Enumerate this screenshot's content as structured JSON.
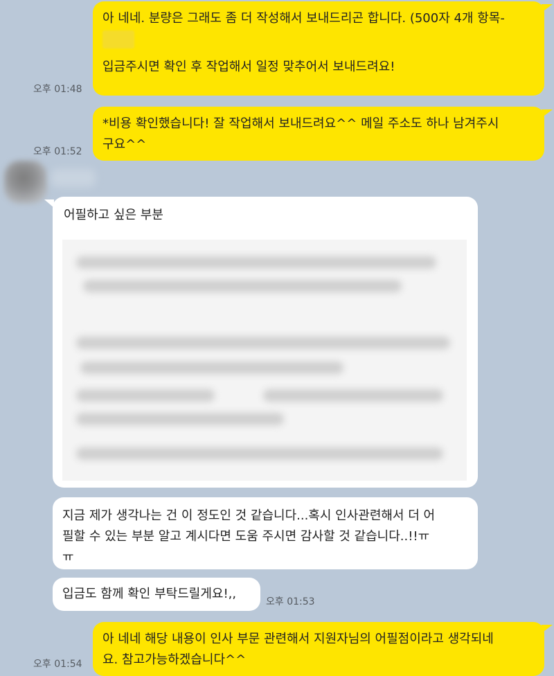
{
  "chat": {
    "messages": [
      {
        "sender": "me",
        "lines": [
          "아 네네. 분량은 그래도 좀 더 작성해서 보내드리곤 합니다. (500자 4개 항목-",
          "",
          "입금주시면 확인 후 작업해서 일정 맞추어서 보내드려요!"
        ],
        "time": "오후 01:48"
      },
      {
        "sender": "me",
        "lines": [
          "*비용 확인했습니다! 잘 작업해서 보내드려요^^ 메일 주소도 하나 남겨주시",
          "구요^^"
        ],
        "time": "오후 01:52"
      },
      {
        "sender": "other",
        "lines": [
          "어필하고 싶은 부분"
        ],
        "note": "blurred-content"
      },
      {
        "sender": "other",
        "lines": [
          "지금 제가 생각나는 건 이 정도인 것 같습니다...혹시 인사관련해서 더 어",
          "필할 수 있는 부분 알고 계시다면 도움 주시면 감사할 것 같습니다..!!ㅠ",
          "ㅠ"
        ]
      },
      {
        "sender": "other",
        "lines": [
          "입금도 함께 확인 부탁드릴게요!,,"
        ],
        "time": "오후 01:53"
      },
      {
        "sender": "me",
        "lines": [
          "아 네네 해당 내용이 인사 부문 관련해서 지원자님의 어필점이라고 생각되네",
          "요. 참고가능하겠습니다^^"
        ],
        "time": "오후 01:54"
      }
    ]
  },
  "colors": {
    "background": "#bac8d8",
    "my_bubble": "#fee500",
    "their_bubble": "#ffffff"
  }
}
